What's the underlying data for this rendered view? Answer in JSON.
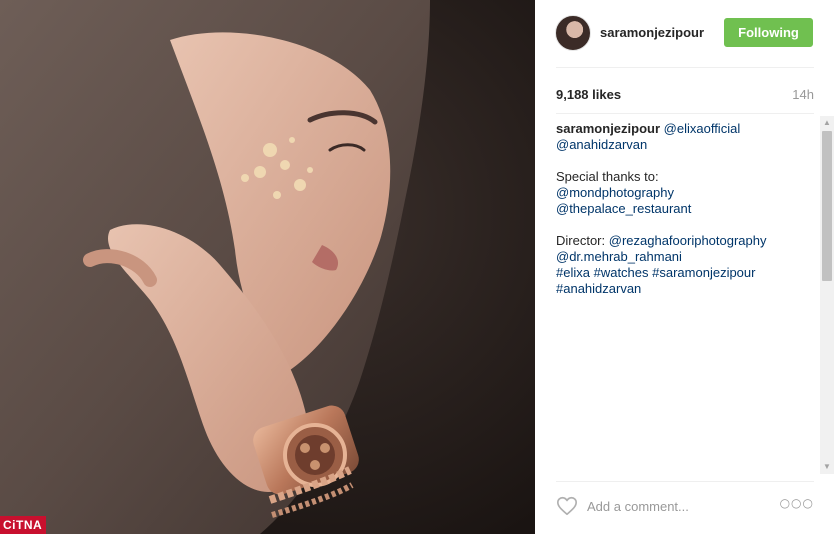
{
  "post": {
    "username": "saramonjezipour",
    "follow_label": "Following",
    "likes": "9,188 likes",
    "timestamp": "14h",
    "caption": {
      "author": "saramonjezipour",
      "mention1": "@elixaofficial",
      "mention2": "@anahidzarvan",
      "thanks_text": "Special thanks to:",
      "mention3": "@mondphotography",
      "mention4": "@thepalace_restaurant",
      "director_text": "Director:",
      "mention5": "@rezaghafooriphotography",
      "mention6": "@dr.mehrab_rahmani",
      "hashtag1": "#elixa",
      "hashtag2": "#watches",
      "hashtag3": "#saramonjezipour",
      "hashtag4": "#anahidzarvan"
    },
    "comment_placeholder": "Add a comment...",
    "more_label": "○○○"
  },
  "watermark": "CiTNA",
  "icons": {
    "heart": "heart-icon",
    "more": "more-options-icon",
    "scroll_up": "scroll-up-arrow-icon",
    "scroll_down": "scroll-down-arrow-icon"
  },
  "colors": {
    "follow_button": "#70c050",
    "link": "#003569",
    "watermark_bg": "#c8102e"
  }
}
